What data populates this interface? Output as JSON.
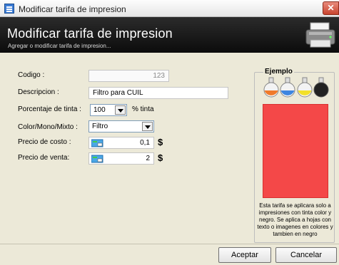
{
  "window": {
    "title": "Modificar tarifa de impresion",
    "close_glyph": "✕"
  },
  "header": {
    "title": "Modificar tarifa de impresion",
    "subtitle": "Agregar o modificar tarifa de impresion..."
  },
  "form": {
    "codigo_label": "Codigo :",
    "codigo_value": "123",
    "descripcion_label": "Descripcion :",
    "descripcion_value": "Filtro para CUIL",
    "porcentaje_label": "Porcentaje de tinta :",
    "porcentaje_value": "100",
    "porcentaje_unit": "% tinta",
    "color_label": "Color/Mono/Mixto :",
    "color_value": "Filtro",
    "costo_label": "Precio de costo :",
    "costo_value": "0,1",
    "venta_label": "Precio de venta:",
    "venta_value": "2",
    "currency": "$"
  },
  "example": {
    "legend": "Ejemplo",
    "swatch_color": "#f44848",
    "description": "Esta tarifa se aplicara solo a impresiones con tinta color y negro. Se aplica a hojas con texto o imagenes en colores y tambien en negro"
  },
  "buttons": {
    "accept": "Aceptar",
    "cancel": "Cancelar"
  }
}
